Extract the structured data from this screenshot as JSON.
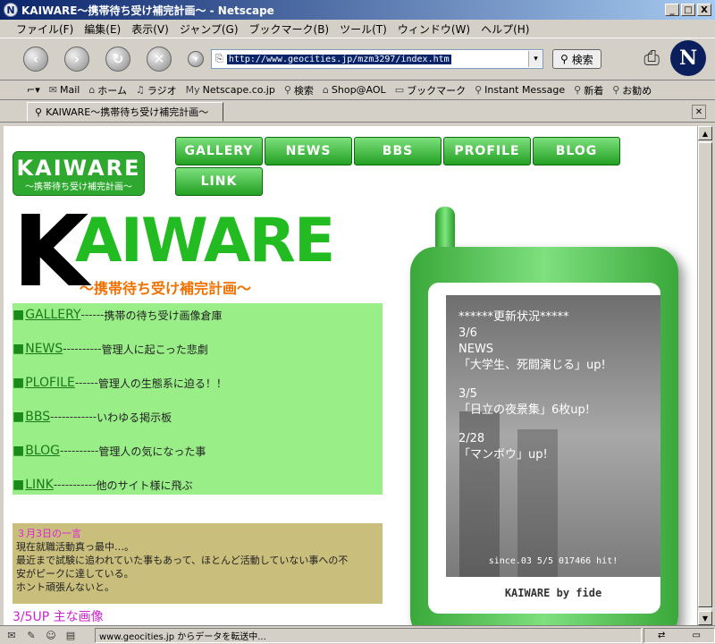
{
  "window": {
    "title": "KAIWARE～携帯待ち受け補完計画～ - Netscape",
    "app_icon": "N",
    "minimize_glyph": "_",
    "maximize_glyph": "□",
    "close_glyph": "X"
  },
  "menu": [
    "ファイル(F)",
    "編集(E)",
    "表示(V)",
    "ジャンプ(G)",
    "ブックマーク(B)",
    "ツール(T)",
    "ウィンドウ(W)",
    "ヘルプ(H)"
  ],
  "nav": {
    "back_glyph": "‹",
    "forward_glyph": "›",
    "reload_glyph": "↻",
    "stop_glyph": "✕",
    "url": "http://www.geocities.jp/mzm3297/index.htm",
    "search_label": "検索",
    "logo_letter": "N"
  },
  "personal": [
    {
      "icon": "mail-icon",
      "glyph": "✉",
      "label": "Mail"
    },
    {
      "icon": "home-icon",
      "glyph": "⌂",
      "label": "ホーム"
    },
    {
      "icon": "radio-icon",
      "glyph": "♫",
      "label": "ラジオ"
    },
    {
      "icon": "my-icon",
      "glyph": "My",
      "label": "Netscape.co.jp"
    },
    {
      "icon": "search-icon",
      "glyph": "⚲",
      "label": "検索"
    },
    {
      "icon": "shop-icon",
      "glyph": "⌂",
      "label": "Shop@AOL"
    },
    {
      "icon": "folder-icon",
      "glyph": "▭",
      "label": "ブックマーク"
    },
    {
      "icon": "bookmark-icon",
      "glyph": "⚲",
      "label": "Instant Message"
    },
    {
      "icon": "bookmark-icon",
      "glyph": "⚲",
      "label": "新着"
    },
    {
      "icon": "bookmark-icon",
      "glyph": "⚲",
      "label": "お勧め"
    }
  ],
  "tab": {
    "label": "KAIWARE～携帯待ち受け補完計画～",
    "close_glyph": "✕"
  },
  "site": {
    "logo_big": "KAIWARE",
    "logo_sub": "～携帯待ち受け補完計画～",
    "nav_row1": [
      "GALLERY",
      "NEWS",
      "BBS",
      "PROFILE",
      "BLOG"
    ],
    "nav_row2": [
      "LINK"
    ],
    "title_k": "K",
    "title_rest": "AIWARE",
    "title_sub": "～携帯待ち受け補完計画～",
    "menu_items": [
      {
        "link": "GALLERY",
        "dash": "------",
        "desc": "携帯の待ち受け画像倉庫"
      },
      {
        "link": "NEWS",
        "dash": "----------",
        "desc": "管理人に起こった悲劇"
      },
      {
        "link": "PLOFILE",
        "dash": "------",
        "desc": " 管理人の生態系に迫る！！"
      },
      {
        "link": "BBS",
        "dash": "------------",
        "desc": "いわゆる掲示板"
      },
      {
        "link": "BLOG",
        "dash": "----------",
        "desc": "管理人の気になった事"
      },
      {
        "link": "LINK",
        "dash": "-----------",
        "desc": "他のサイト様に飛ぶ"
      }
    ],
    "square_glyph": "■",
    "diary_heading": "３月3日の一言",
    "diary_lines": [
      "現在就職活動真っ最中…。",
      "最近まで試験に追われていた事もあって、ほとんど活動していない事への不",
      "安がピークに達している。",
      "ホント頑張んないと。"
    ],
    "update_heading": "3/5UP 主な画像"
  },
  "phone": {
    "header": "******更新状況*****",
    "updates": [
      {
        "date": "3/6",
        "lines": [
          "NEWS",
          "「大学生、死闘演じる」up!"
        ]
      },
      {
        "date": "3/5",
        "lines": [
          "「日立の夜景集」6枚up!"
        ]
      },
      {
        "date": "2/28",
        "lines": [
          "「マンボウ」up!"
        ]
      }
    ],
    "since": "since.03 5/5 017466 hit!",
    "brand": "KAIWARE by fide"
  },
  "status": {
    "text": "www.geocities.jp からデータを転送中..."
  }
}
